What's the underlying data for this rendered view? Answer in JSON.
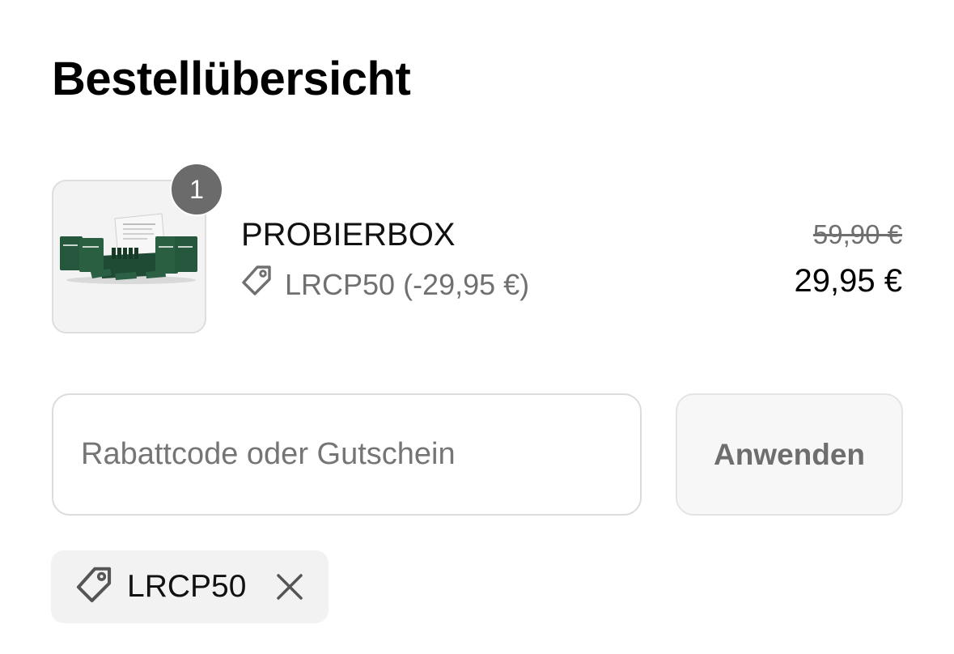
{
  "header": {
    "title": "Bestellübersicht"
  },
  "line_item": {
    "quantity": "1",
    "name": "PROBIERBOX",
    "discount_icon": "tag-icon",
    "discount_text": "LRCP50 (-29,95 €)",
    "price_original": "59,90 €",
    "price_final": "29,95 €"
  },
  "discount_form": {
    "placeholder": "Rabattcode oder Gutschein",
    "value": "",
    "apply_label": "Anwenden"
  },
  "applied_code": {
    "icon": "tag-icon",
    "code": "LRCP50",
    "remove_icon": "close-icon"
  },
  "colors": {
    "badge": "#6b6b6b",
    "muted_text": "#707070",
    "border": "#dcdcdc",
    "chip_bg": "#f2f2f2",
    "product_green": "#1f4a33"
  }
}
